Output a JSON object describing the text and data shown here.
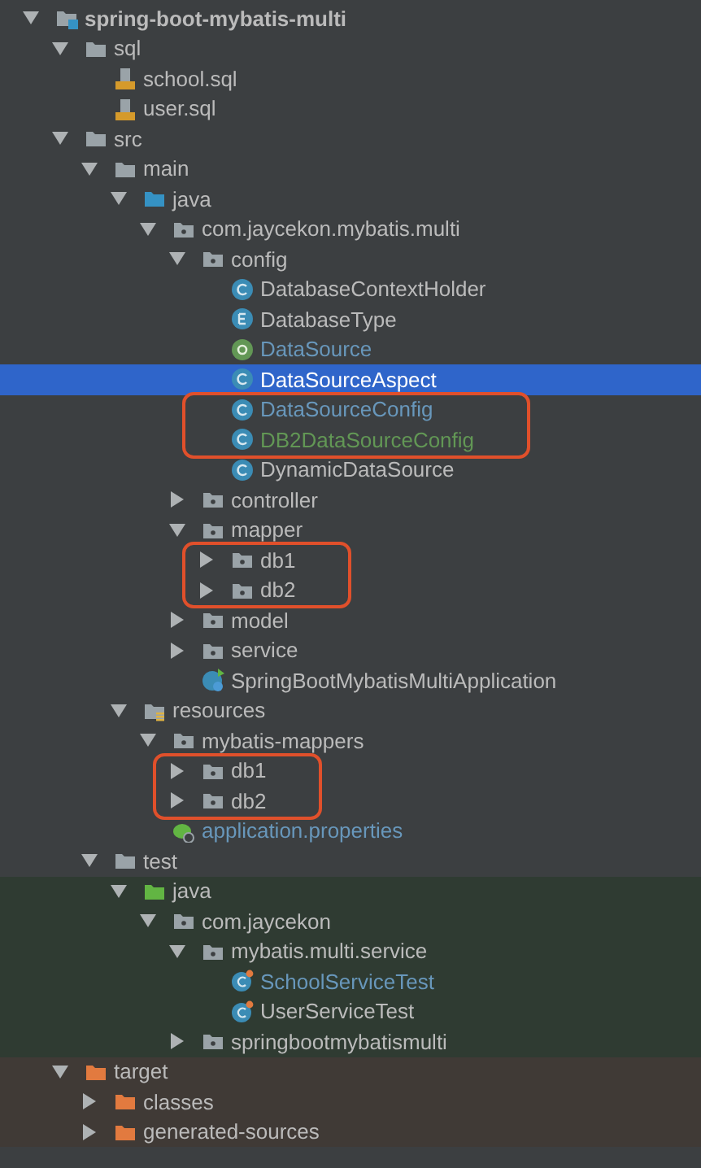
{
  "tree": [
    {
      "label": "spring-boot-mybatis-multi",
      "kind": "module",
      "expanded": true,
      "children": [
        {
          "label": "sql",
          "kind": "folder",
          "expanded": true,
          "children": [
            {
              "label": "school.sql",
              "kind": "sql"
            },
            {
              "label": "user.sql",
              "kind": "sql"
            }
          ]
        },
        {
          "label": "src",
          "kind": "folder",
          "expanded": true,
          "children": [
            {
              "label": "main",
              "kind": "folder",
              "expanded": true,
              "children": [
                {
                  "label": "java",
                  "kind": "source",
                  "expanded": true,
                  "children": [
                    {
                      "label": "com.jaycekon.mybatis.multi",
                      "kind": "package",
                      "expanded": true,
                      "children": [
                        {
                          "label": "config",
                          "kind": "package",
                          "expanded": true,
                          "children": [
                            {
                              "label": "DatabaseContextHolder",
                              "kind": "class",
                              "color": "#bbbbbb",
                              "selected": false
                            },
                            {
                              "label": "DatabaseType",
                              "kind": "enum",
                              "color": "#bbbbbb",
                              "selected": false
                            },
                            {
                              "label": "DataSource",
                              "kind": "annotation",
                              "color": "#6897bb",
                              "selected": false
                            },
                            {
                              "label": "DataSourceAspect",
                              "kind": "class",
                              "color": "#ffffff",
                              "selected": true
                            },
                            {
                              "label": "DataSourceConfig",
                              "kind": "class",
                              "color": "#6897bb",
                              "selected": false,
                              "highlighted": true
                            },
                            {
                              "label": "DB2DataSourceConfig",
                              "kind": "class",
                              "color": "#629755",
                              "selected": false,
                              "highlighted": true
                            },
                            {
                              "label": "DynamicDataSource",
                              "kind": "class",
                              "color": "#bbbbbb",
                              "selected": false
                            }
                          ]
                        },
                        {
                          "label": "controller",
                          "kind": "package",
                          "expanded": false
                        },
                        {
                          "label": "mapper",
                          "kind": "package",
                          "expanded": true,
                          "children": [
                            {
                              "label": "db1",
                              "kind": "package",
                              "expanded": false,
                              "highlighted": true
                            },
                            {
                              "label": "db2",
                              "kind": "package",
                              "expanded": false,
                              "highlighted": true
                            }
                          ]
                        },
                        {
                          "label": "model",
                          "kind": "package",
                          "expanded": false
                        },
                        {
                          "label": "service",
                          "kind": "package",
                          "expanded": false
                        },
                        {
                          "label": "SpringBootMybatisMultiApplication",
                          "kind": "boot",
                          "color": "#bbbbbb"
                        }
                      ]
                    }
                  ]
                },
                {
                  "label": "resources",
                  "kind": "resources",
                  "expanded": true,
                  "children": [
                    {
                      "label": "mybatis-mappers",
                      "kind": "package",
                      "expanded": true,
                      "children": [
                        {
                          "label": "db1",
                          "kind": "package",
                          "expanded": false,
                          "highlighted": true
                        },
                        {
                          "label": "db2",
                          "kind": "package",
                          "expanded": false,
                          "highlighted": true
                        }
                      ]
                    },
                    {
                      "label": "application.properties",
                      "kind": "properties",
                      "color": "#6897bb"
                    }
                  ]
                }
              ]
            },
            {
              "label": "test",
              "kind": "folder",
              "expanded": true,
              "children": [
                {
                  "label": "java",
                  "kind": "test",
                  "expanded": true,
                  "children": [
                    {
                      "label": "com.jaycekon",
                      "kind": "package",
                      "expanded": true,
                      "children": [
                        {
                          "label": "mybatis.multi.service",
                          "kind": "package",
                          "expanded": true,
                          "children": [
                            {
                              "label": "SchoolServiceTest",
                              "kind": "testclass",
                              "color": "#6897bb"
                            },
                            {
                              "label": "UserServiceTest",
                              "kind": "testclass",
                              "color": "#bbbbbb"
                            }
                          ]
                        },
                        {
                          "label": "springbootmybatismulti",
                          "kind": "package",
                          "expanded": false
                        }
                      ]
                    }
                  ]
                }
              ]
            }
          ]
        },
        {
          "label": "target",
          "kind": "excluded",
          "expanded": true,
          "children": [
            {
              "label": "classes",
              "kind": "excluded",
              "expanded": false
            },
            {
              "label": "generated-sources",
              "kind": "excluded",
              "expanded": false
            }
          ]
        }
      ]
    }
  ]
}
